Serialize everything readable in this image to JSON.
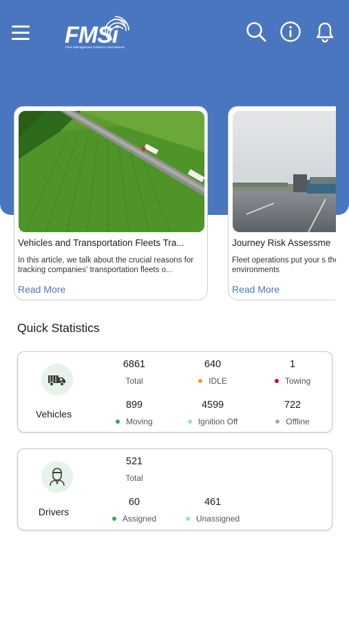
{
  "header": {
    "logo_text": "FMSi",
    "logo_subtitle": "Fleet Management Systems International",
    "icons": [
      "hamburger-menu-icon",
      "search-icon",
      "info-icon",
      "bell-icon"
    ],
    "background_color": "#4a76bf"
  },
  "articles": [
    {
      "title": "Vehicles and Transportation Fleets Tra...",
      "excerpt": "In this article, we talk about the crucial reasons for tracking companies' transportation fleets o...",
      "link": "Read More"
    },
    {
      "title": "Journey Risk Assessme",
      "excerpt": "Fleet operations put your s the dynamic environments",
      "link": "Read More"
    }
  ],
  "quick_statistics": {
    "title": "Quick Statistics",
    "vehicles": {
      "label": "Vehicles",
      "icon": "truck-icon",
      "total": {
        "value": "6861",
        "label": "Total"
      },
      "idle": {
        "value": "640",
        "label": "IDLE",
        "color": "#e0a030"
      },
      "towing": {
        "value": "1",
        "label": "Towing",
        "color": "#c8102e"
      },
      "moving": {
        "value": "899",
        "label": "Moving",
        "color": "#2fa84f"
      },
      "ignition_off": {
        "value": "4599",
        "label": "Ignition Off",
        "color": "#8fe3d0"
      },
      "offline": {
        "value": "722",
        "label": "Offline",
        "color": "#a8a8a8"
      }
    },
    "drivers": {
      "label": "Drivers",
      "icon": "driver-icon",
      "total": {
        "value": "521",
        "label": "Total"
      },
      "assigned": {
        "value": "60",
        "label": "Assigned",
        "color": "#2fa84f"
      },
      "unassigned": {
        "value": "461",
        "label": "Unassigned",
        "color": "#8fe3d0"
      }
    }
  }
}
